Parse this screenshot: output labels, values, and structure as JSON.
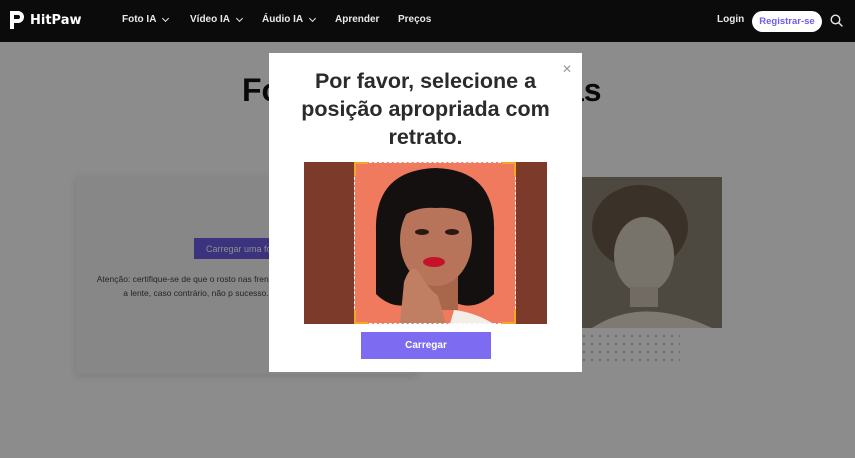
{
  "nav": {
    "brand": "HitPaw",
    "items": [
      {
        "label": "Foto IA",
        "has_dropdown": true
      },
      {
        "label": "Vídeo IA",
        "has_dropdown": true
      },
      {
        "label": "Áudio IA",
        "has_dropdown": true
      },
      {
        "label": "Aprender",
        "has_dropdown": false
      },
      {
        "label": "Preços",
        "has_dropdown": false
      }
    ],
    "login": "Login",
    "register": "Registrar-se",
    "search_icon": "search-icon"
  },
  "page": {
    "title_left": "Fo",
    "title_right": "as",
    "card_button": "Carregar uma fo",
    "card_note": "Atenção: certifique-se de que o rosto nas frente para a lente, caso contrário, não p sucesso."
  },
  "modal": {
    "title": "Por favor, selecione a posição apropriada com retrato.",
    "close_icon": "close-icon",
    "upload_button": "Carregar"
  },
  "colors": {
    "navbar": "#0b0b0b",
    "accent": "#7d6cf2",
    "crop_background": "#7c3b2a",
    "crop_window": "#f07a5e",
    "crop_handles": "#f5a623"
  }
}
